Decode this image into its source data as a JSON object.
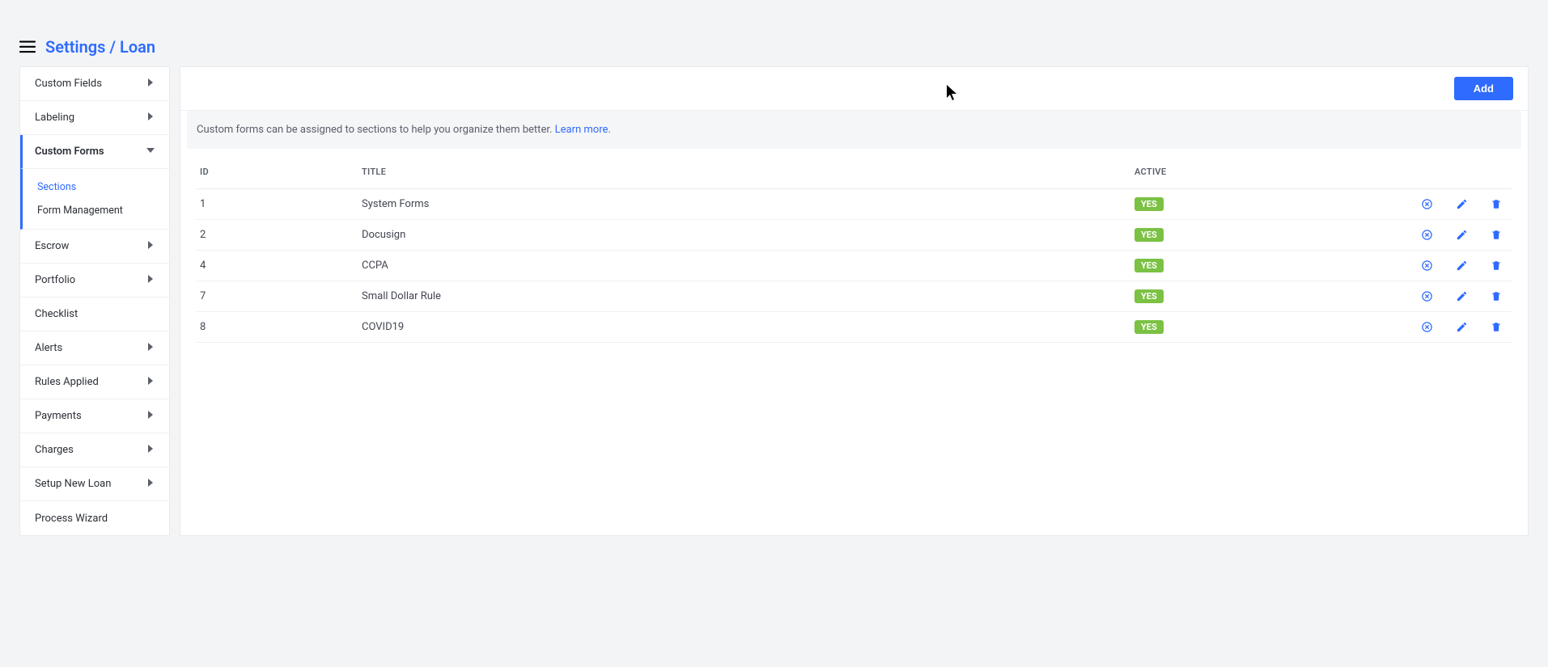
{
  "breadcrumb": {
    "settings": "Settings",
    "separator": "/",
    "current": "Loan"
  },
  "sidebar": {
    "items": [
      {
        "label": "Custom Fields",
        "expandable": true
      },
      {
        "label": "Labeling",
        "expandable": true
      },
      {
        "label": "Custom Forms",
        "expandable": true,
        "active": true,
        "sub": [
          {
            "label": "Sections",
            "selected": true
          },
          {
            "label": "Form Management"
          }
        ]
      },
      {
        "label": "Escrow",
        "expandable": true
      },
      {
        "label": "Portfolio",
        "expandable": true
      },
      {
        "label": "Checklist",
        "expandable": false
      },
      {
        "label": "Alerts",
        "expandable": true
      },
      {
        "label": "Rules Applied",
        "expandable": true
      },
      {
        "label": "Payments",
        "expandable": true
      },
      {
        "label": "Charges",
        "expandable": true
      },
      {
        "label": "Setup New Loan",
        "expandable": true
      },
      {
        "label": "Process Wizard",
        "expandable": false
      }
    ]
  },
  "toolbar": {
    "add_label": "Add"
  },
  "info": {
    "text": "Custom forms can be assigned to sections to help you organize them better. ",
    "link": "Learn more"
  },
  "table": {
    "headers": {
      "id": "ID",
      "title": "TITLE",
      "active": "ACTIVE"
    },
    "rows": [
      {
        "id": "1",
        "title": "System Forms",
        "active": "YES"
      },
      {
        "id": "2",
        "title": "Docusign",
        "active": "YES"
      },
      {
        "id": "4",
        "title": "CCPA",
        "active": "YES"
      },
      {
        "id": "7",
        "title": "Small Dollar Rule",
        "active": "YES"
      },
      {
        "id": "8",
        "title": "COVID19",
        "active": "YES"
      }
    ]
  }
}
